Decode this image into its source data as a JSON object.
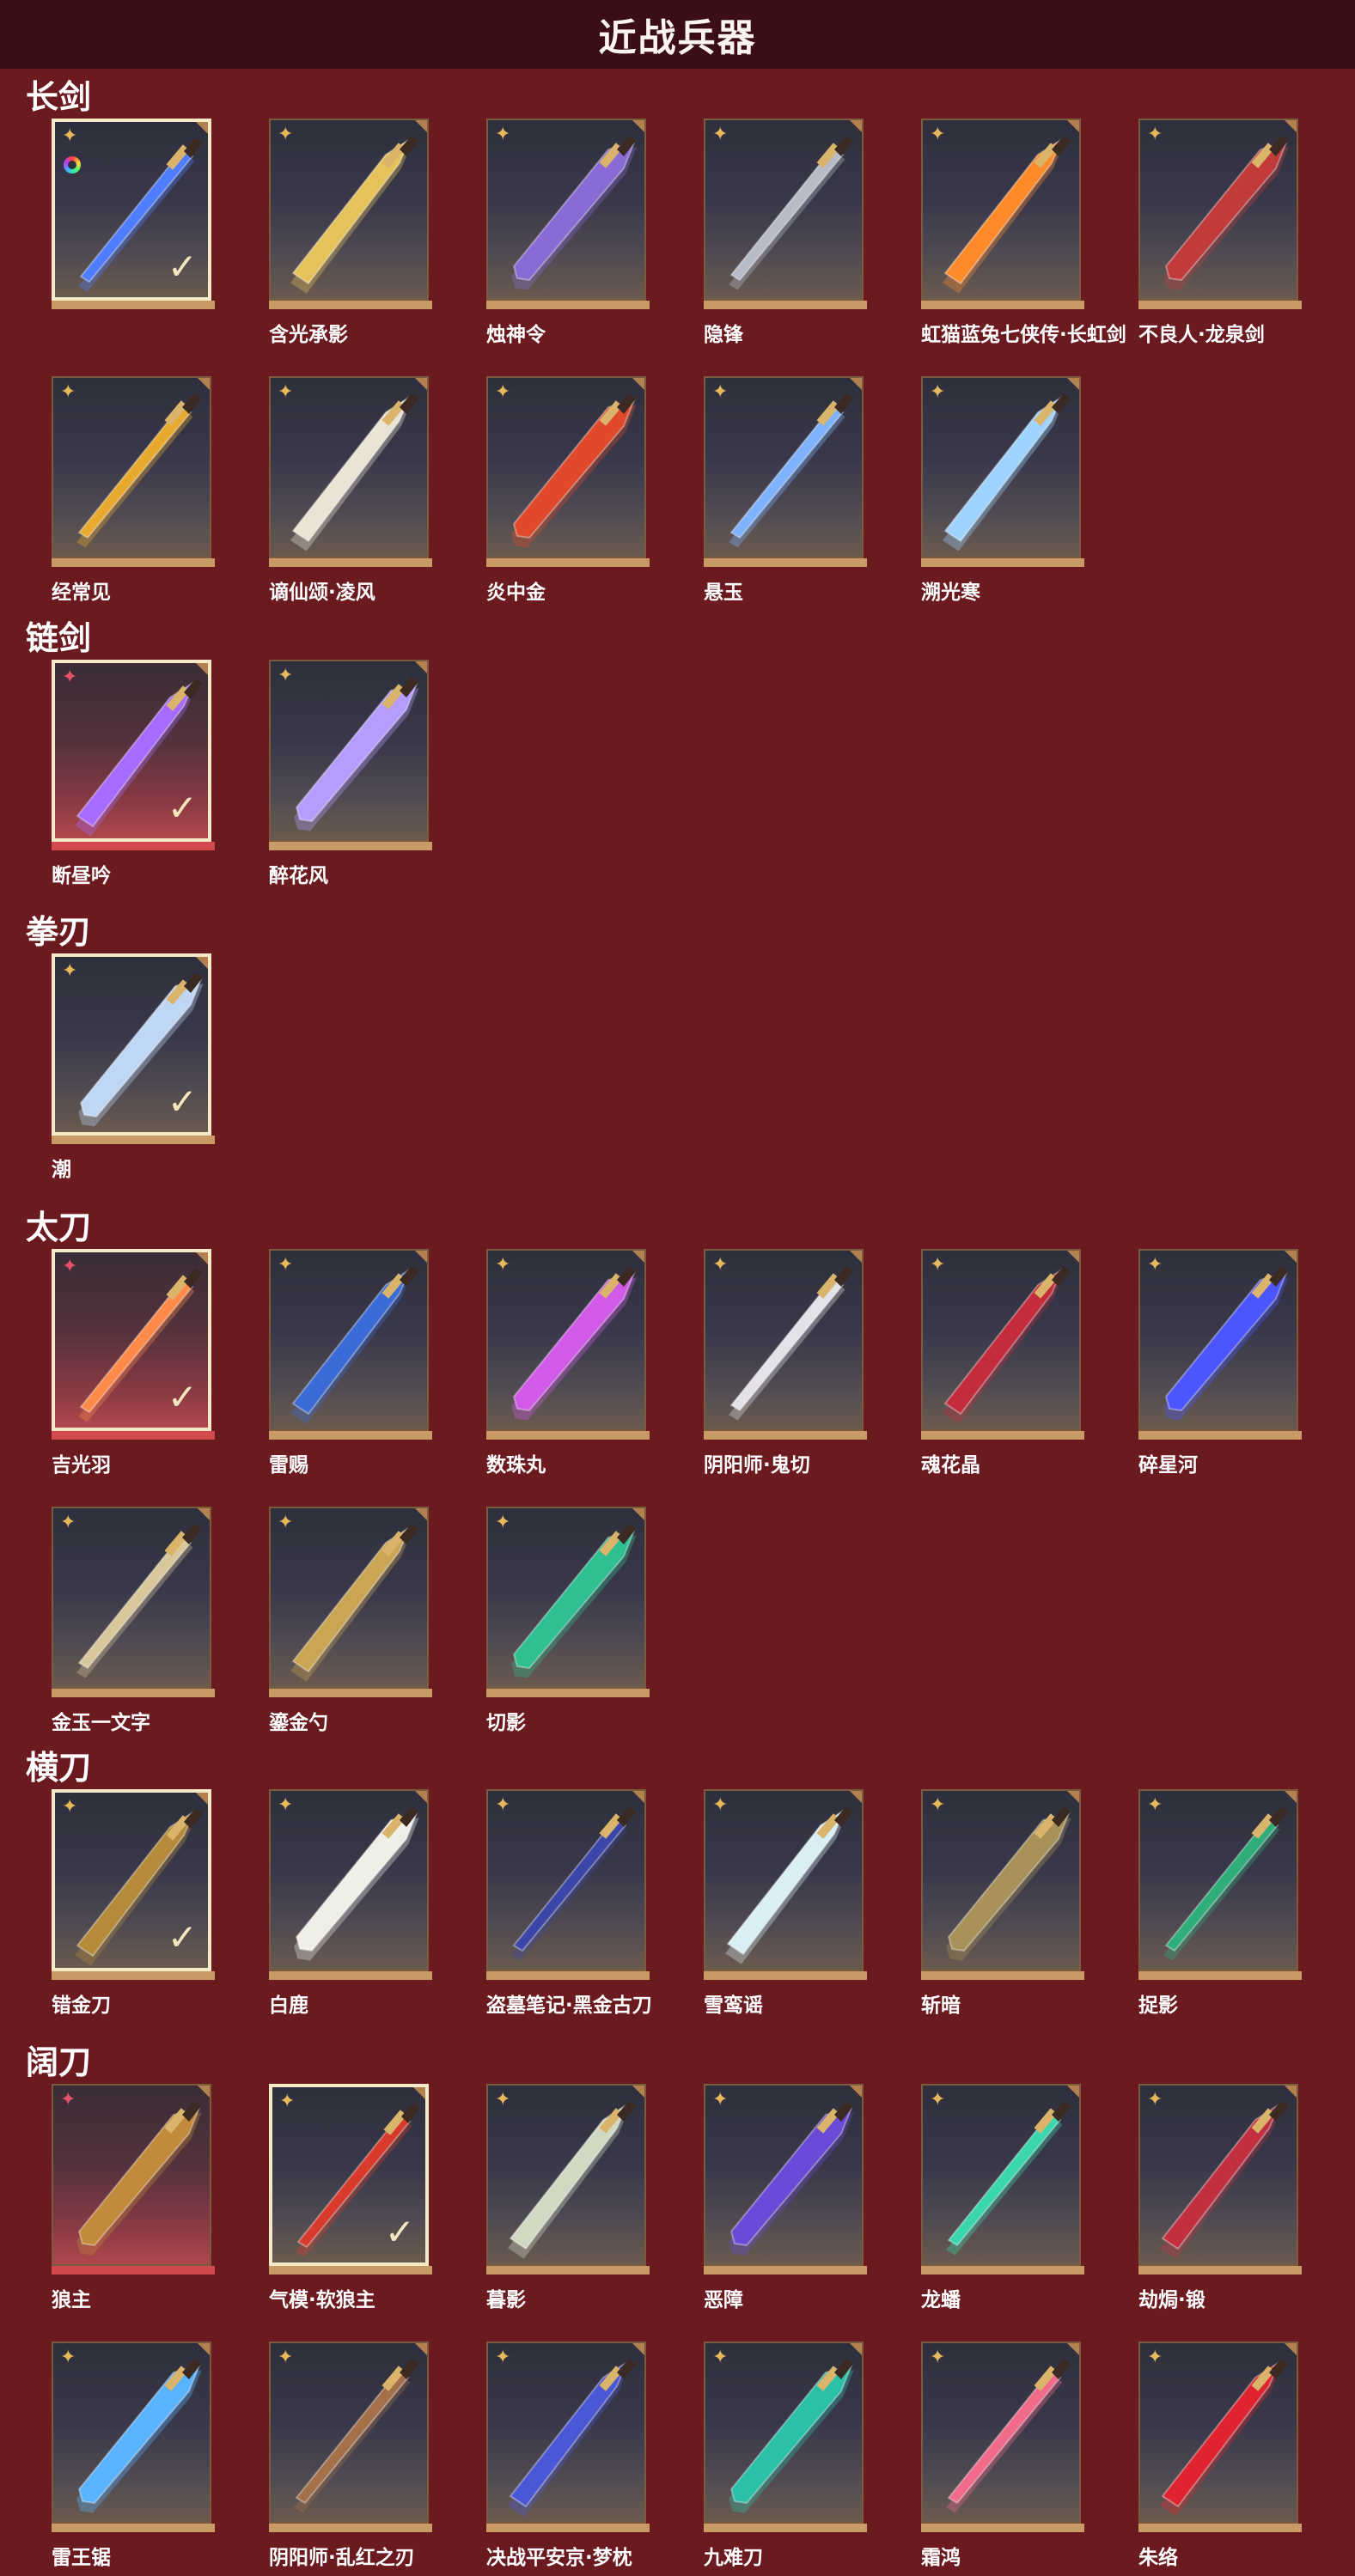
{
  "page": {
    "title": "近战兵器"
  },
  "categories": [
    {
      "name": "长剑",
      "items": [
        {
          "name": "",
          "selected": true,
          "rarity": "gold",
          "special_ring": true,
          "color": "#4f7dff"
        },
        {
          "name": "含光承影",
          "rarity": "gold",
          "color": "#e6c25a"
        },
        {
          "name": "烛神令",
          "rarity": "gold",
          "color": "#8a6bd6"
        },
        {
          "name": "隐锋",
          "rarity": "gold",
          "color": "#b8bcc8"
        },
        {
          "name": "虹猫蓝兔七侠传·长虹剑",
          "rarity": "gold",
          "color": "#ff8a2a"
        },
        {
          "name": "不良人·龙泉剑",
          "rarity": "gold",
          "color": "#c23b3b"
        },
        {
          "name": "经常见",
          "rarity": "gold",
          "color": "#e8a92f"
        },
        {
          "name": "谪仙颂·凌风",
          "rarity": "gold",
          "color": "#e9e4d4"
        },
        {
          "name": "炎中金",
          "rarity": "gold",
          "color": "#e0492a"
        },
        {
          "name": "悬玉",
          "rarity": "gold",
          "color": "#7fb3ff"
        },
        {
          "name": "溯光寒",
          "rarity": "gold",
          "color": "#9fd3ff"
        }
      ]
    },
    {
      "name": "链剑",
      "items": [
        {
          "name": "断昼吟",
          "selected": true,
          "rarity": "red",
          "color": "#a76cff"
        },
        {
          "name": "醉花风",
          "rarity": "gold",
          "color": "#b79cff"
        }
      ]
    },
    {
      "name": "拳刃",
      "items": [
        {
          "name": "潮",
          "selected": true,
          "rarity": "gold",
          "color": "#bfd7f5"
        }
      ]
    },
    {
      "name": "太刀",
      "items": [
        {
          "name": "吉光羽",
          "selected": true,
          "rarity": "red",
          "color": "#ff8a4a"
        },
        {
          "name": "雷赐",
          "rarity": "gold",
          "color": "#3b6bd6"
        },
        {
          "name": "数珠丸",
          "rarity": "gold",
          "color": "#d25ae8"
        },
        {
          "name": "阴阳师·鬼切",
          "rarity": "gold",
          "color": "#e2e2e8"
        },
        {
          "name": "魂花晶",
          "rarity": "gold",
          "color": "#c42b3b"
        },
        {
          "name": "碎星河",
          "rarity": "gold",
          "color": "#4b56ff"
        },
        {
          "name": "金玉一文字",
          "rarity": "gold",
          "color": "#d8c79a"
        },
        {
          "name": "鎏金勺",
          "rarity": "gold",
          "color": "#c9a554"
        },
        {
          "name": "切影",
          "rarity": "gold",
          "color": "#2fbf90"
        }
      ]
    },
    {
      "name": "横刀",
      "items": [
        {
          "name": "错金刀",
          "selected": true,
          "rarity": "gold",
          "color": "#b58a3a"
        },
        {
          "name": "白鹿",
          "rarity": "gold",
          "color": "#efefe8"
        },
        {
          "name": "盗墓笔记·黑金古刀",
          "rarity": "gold",
          "color": "#3b46a8"
        },
        {
          "name": "雪鸾谣",
          "rarity": "gold",
          "color": "#d9eef5"
        },
        {
          "name": "斩暗",
          "rarity": "gold",
          "color": "#a8925a"
        },
        {
          "name": "捉影",
          "rarity": "gold",
          "color": "#2fae7a"
        }
      ]
    },
    {
      "name": "阔刀",
      "items": [
        {
          "name": "狼主",
          "rarity": "red",
          "color": "#c28a3a"
        },
        {
          "name": "气模·软狼主",
          "selected": true,
          "rarity": "gold",
          "color": "#d83b2b"
        },
        {
          "name": "暮影",
          "rarity": "gold",
          "color": "#d2d9c2"
        },
        {
          "name": "恶障",
          "rarity": "gold",
          "color": "#6a4ad6"
        },
        {
          "name": "龙蟠",
          "rarity": "gold",
          "color": "#3bd6b0"
        },
        {
          "name": "劫焗·锻",
          "rarity": "gold",
          "color": "#c23040"
        },
        {
          "name": "雷王锯",
          "rarity": "gold",
          "color": "#5ab3ff"
        },
        {
          "name": "阴阳师·乱红之刃",
          "rarity": "gold",
          "color": "#a3704a"
        },
        {
          "name": "决战平安京·梦枕",
          "rarity": "gold",
          "color": "#4b58d6"
        },
        {
          "name": "九难刀",
          "rarity": "gold",
          "color": "#2bc0a8"
        },
        {
          "name": "霜鸿",
          "rarity": "gold",
          "color": "#f06a8a"
        },
        {
          "name": "朱络",
          "rarity": "gold",
          "color": "#e0242f"
        }
      ]
    }
  ]
}
